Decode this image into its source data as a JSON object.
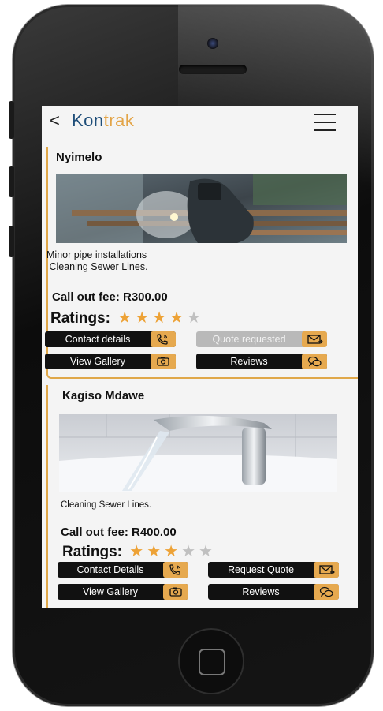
{
  "app": {
    "title_part1": "Kon",
    "title_part2": "trak",
    "back_icon": "chevron-left-icon",
    "menu_icon": "hamburger-menu-icon"
  },
  "colors": {
    "accent": "#e3a447",
    "brand_blue": "#1f4e79",
    "button_bg": "#111111",
    "star_on": "#eda236",
    "star_off": "#c0c0c0"
  },
  "listings": [
    {
      "name": "Nyimelo",
      "image": "welder-working-on-pipes",
      "desc_line1": "Minor pipe installations",
      "desc_line2": " Cleaning Sewer Lines.",
      "fee": "Call out fee: R300.00",
      "ratings_label": "Ratings:",
      "rating": 4,
      "rating_max": 5,
      "buttons": {
        "contact": "Contact details",
        "quote": "Quote requested",
        "gallery": "View Gallery",
        "reviews": "Reviews"
      }
    },
    {
      "name": "Kagiso Mdawe",
      "image": "running-tap-water",
      "desc_line1": "Cleaning Sewer Lines.",
      "fee": "Call out fee: R400.00",
      "ratings_label": "Ratings:",
      "rating": 3,
      "rating_max": 5,
      "buttons": {
        "contact": "Contact Details",
        "quote": "Request Quote",
        "gallery": "View Gallery",
        "reviews": "Reviews"
      }
    }
  ]
}
